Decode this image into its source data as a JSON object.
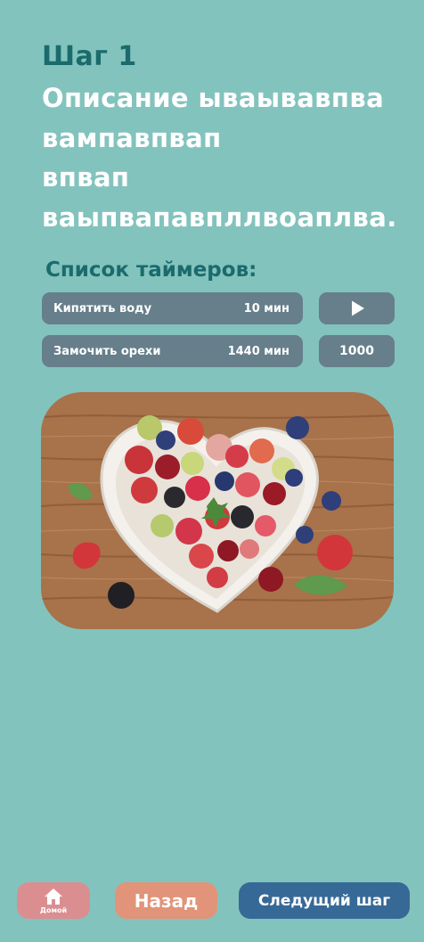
{
  "step": {
    "label": "Шаг 1",
    "description": "Описание ываывавпва\nвампавпвап\nвпвап\nваыпвапавпллвоаплва."
  },
  "timers": {
    "title": "Список таймеров:",
    "items": [
      {
        "name": "Кипятить воду",
        "duration": "10 мин",
        "action_icon": "play-icon"
      },
      {
        "name": "Замочить орехи",
        "duration": "1440 мин",
        "action_value": "1000"
      }
    ]
  },
  "image": {
    "subject": "fruit-and-berry-salad-heart-bowl-photo"
  },
  "nav": {
    "home_label": "Домой",
    "back_label": "Назад",
    "next_label": "Следущий шаг"
  },
  "colors": {
    "background": "#83c3bd",
    "heading": "#1a6b6c",
    "timer_pill": "#667f8b",
    "home_button": "#db8e90",
    "back_button": "#e19479",
    "next_button": "#376996"
  }
}
